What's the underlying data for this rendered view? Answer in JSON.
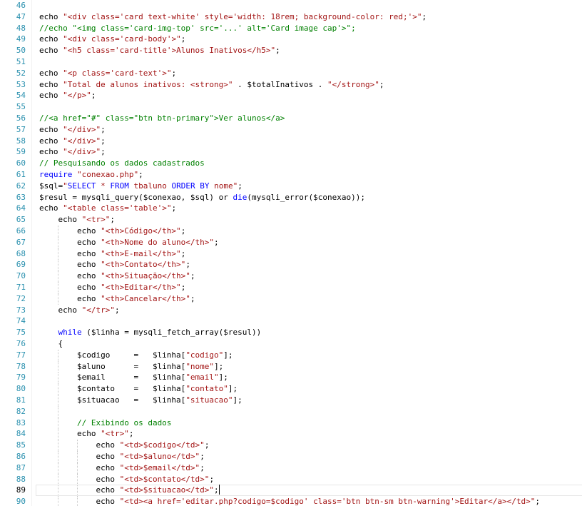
{
  "editor": {
    "active_line": 89,
    "lines": [
      {
        "n": "46",
        "t": []
      },
      {
        "n": "47",
        "t": [
          [
            "pl",
            "echo "
          ],
          [
            "str",
            "\"<div class='card text-white' style='width: 18rem; background-color: red;'>\""
          ],
          [
            "pl",
            ";"
          ]
        ]
      },
      {
        "n": "48",
        "t": [
          [
            "cm",
            "//echo \"<img class='card-img-top' src='...' alt='Card image cap'>\";"
          ]
        ]
      },
      {
        "n": "49",
        "t": [
          [
            "pl",
            "echo "
          ],
          [
            "str",
            "\"<div class='card-body'>\""
          ],
          [
            "pl",
            ";"
          ]
        ]
      },
      {
        "n": "50",
        "t": [
          [
            "pl",
            "echo "
          ],
          [
            "str",
            "\"<h5 class='card-title'>Alunos Inativos</h5>\""
          ],
          [
            "pl",
            ";"
          ]
        ]
      },
      {
        "n": "51",
        "t": []
      },
      {
        "n": "52",
        "t": [
          [
            "pl",
            "echo "
          ],
          [
            "str",
            "\"<p class='card-text'>\""
          ],
          [
            "pl",
            ";"
          ]
        ]
      },
      {
        "n": "53",
        "t": [
          [
            "pl",
            "echo "
          ],
          [
            "str",
            "\"Total de alunos inativos: <strong>\""
          ],
          [
            "pl",
            " . $totalInativos . "
          ],
          [
            "str",
            "\"</strong>\""
          ],
          [
            "pl",
            ";"
          ]
        ]
      },
      {
        "n": "54",
        "t": [
          [
            "pl",
            "echo "
          ],
          [
            "str",
            "\"</p>\""
          ],
          [
            "pl",
            ";"
          ]
        ]
      },
      {
        "n": "55",
        "t": []
      },
      {
        "n": "56",
        "t": [
          [
            "cm",
            "//<a href=\"#\" class=\"btn btn-primary\">Ver alunos</a>"
          ]
        ]
      },
      {
        "n": "57",
        "t": [
          [
            "pl",
            "echo "
          ],
          [
            "str",
            "\"</div>\""
          ],
          [
            "pl",
            ";"
          ]
        ]
      },
      {
        "n": "58",
        "t": [
          [
            "pl",
            "echo "
          ],
          [
            "str",
            "\"</div>\""
          ],
          [
            "pl",
            ";"
          ]
        ]
      },
      {
        "n": "59",
        "t": [
          [
            "pl",
            "echo "
          ],
          [
            "str",
            "\"</div>\""
          ],
          [
            "pl",
            ";"
          ]
        ]
      },
      {
        "n": "60",
        "t": [
          [
            "cm",
            "// Pesquisando os dados cadastrados"
          ]
        ]
      },
      {
        "n": "61",
        "t": [
          [
            "kw",
            "require "
          ],
          [
            "str",
            "\"conexao.php\""
          ],
          [
            "pl",
            ";"
          ]
        ]
      },
      {
        "n": "62",
        "t": [
          [
            "pl",
            "$sql="
          ],
          [
            "str",
            "\""
          ],
          [
            "sql",
            "SELECT"
          ],
          [
            "str",
            " * "
          ],
          [
            "sql",
            "FROM"
          ],
          [
            "str",
            " tbaluno "
          ],
          [
            "sql",
            "ORDER BY"
          ],
          [
            "str",
            " nome\""
          ],
          [
            "pl",
            ";"
          ]
        ]
      },
      {
        "n": "63",
        "t": [
          [
            "pl",
            "$resul = mysqli_query($conexao, $sql) or "
          ],
          [
            "kw",
            "die"
          ],
          [
            "pl",
            "(mysqli_error($conexao));"
          ]
        ]
      },
      {
        "n": "64",
        "t": [
          [
            "pl",
            "echo "
          ],
          [
            "str",
            "\"<table class='table'>\""
          ],
          [
            "pl",
            ";"
          ]
        ]
      },
      {
        "n": "65",
        "t": [
          [
            "pl",
            "    echo "
          ],
          [
            "str",
            "\"<tr>\""
          ],
          [
            "pl",
            ";"
          ]
        ]
      },
      {
        "n": "66",
        "t": [
          [
            "pl",
            "        echo "
          ],
          [
            "str",
            "\"<th>Código</th>\""
          ],
          [
            "pl",
            ";"
          ]
        ]
      },
      {
        "n": "67",
        "t": [
          [
            "pl",
            "        echo "
          ],
          [
            "str",
            "\"<th>Nome do aluno</th>\""
          ],
          [
            "pl",
            ";"
          ]
        ]
      },
      {
        "n": "68",
        "t": [
          [
            "pl",
            "        echo "
          ],
          [
            "str",
            "\"<th>E-mail</th>\""
          ],
          [
            "pl",
            ";"
          ]
        ]
      },
      {
        "n": "69",
        "t": [
          [
            "pl",
            "        echo "
          ],
          [
            "str",
            "\"<th>Contato</th>\""
          ],
          [
            "pl",
            ";"
          ]
        ]
      },
      {
        "n": "70",
        "t": [
          [
            "pl",
            "        echo "
          ],
          [
            "str",
            "\"<th>Situação</th>\""
          ],
          [
            "pl",
            ";"
          ]
        ]
      },
      {
        "n": "71",
        "t": [
          [
            "pl",
            "        echo "
          ],
          [
            "str",
            "\"<th>Editar</th>\""
          ],
          [
            "pl",
            ";"
          ]
        ]
      },
      {
        "n": "72",
        "t": [
          [
            "pl",
            "        echo "
          ],
          [
            "str",
            "\"<th>Cancelar</th>\""
          ],
          [
            "pl",
            ";"
          ]
        ]
      },
      {
        "n": "73",
        "t": [
          [
            "pl",
            "    echo "
          ],
          [
            "str",
            "\"</tr>\""
          ],
          [
            "pl",
            ";"
          ]
        ]
      },
      {
        "n": "74",
        "t": []
      },
      {
        "n": "75",
        "t": [
          [
            "kw",
            "    while"
          ],
          [
            "pl",
            " ($linha = mysqli_fetch_array($resul))"
          ]
        ]
      },
      {
        "n": "76",
        "t": [
          [
            "pl",
            "    {"
          ]
        ]
      },
      {
        "n": "77",
        "t": [
          [
            "pl",
            "        $codigo     =   $linha["
          ],
          [
            "str",
            "\"codigo\""
          ],
          [
            "pl",
            "];"
          ]
        ]
      },
      {
        "n": "78",
        "t": [
          [
            "pl",
            "        $aluno      =   $linha["
          ],
          [
            "str",
            "\"nome\""
          ],
          [
            "pl",
            "];"
          ]
        ]
      },
      {
        "n": "79",
        "t": [
          [
            "pl",
            "        $email      =   $linha["
          ],
          [
            "str",
            "\"email\""
          ],
          [
            "pl",
            "];"
          ]
        ]
      },
      {
        "n": "80",
        "t": [
          [
            "pl",
            "        $contato    =   $linha["
          ],
          [
            "str",
            "\"contato\""
          ],
          [
            "pl",
            "];"
          ]
        ]
      },
      {
        "n": "81",
        "t": [
          [
            "pl",
            "        $situacao   =   $linha["
          ],
          [
            "str",
            "\"situacao\""
          ],
          [
            "pl",
            "];"
          ]
        ]
      },
      {
        "n": "82",
        "t": []
      },
      {
        "n": "83",
        "t": [
          [
            "cm",
            "        // Exibindo os dados"
          ]
        ]
      },
      {
        "n": "84",
        "t": [
          [
            "pl",
            "        echo "
          ],
          [
            "str",
            "\"<tr>\""
          ],
          [
            "pl",
            ";"
          ]
        ]
      },
      {
        "n": "85",
        "t": [
          [
            "pl",
            "            echo "
          ],
          [
            "str",
            "\"<td>$codigo</td>\""
          ],
          [
            "pl",
            ";"
          ]
        ]
      },
      {
        "n": "86",
        "t": [
          [
            "pl",
            "            echo "
          ],
          [
            "str",
            "\"<td>$aluno</td>\""
          ],
          [
            "pl",
            ";"
          ]
        ]
      },
      {
        "n": "87",
        "t": [
          [
            "pl",
            "            echo "
          ],
          [
            "str",
            "\"<td>$email</td>\""
          ],
          [
            "pl",
            ";"
          ]
        ]
      },
      {
        "n": "88",
        "t": [
          [
            "pl",
            "            echo "
          ],
          [
            "str",
            "\"<td>$contato</td>\""
          ],
          [
            "pl",
            ";"
          ]
        ]
      },
      {
        "n": "89",
        "t": [
          [
            "pl",
            "            echo "
          ],
          [
            "str",
            "\"<td>$situacao</td>\""
          ],
          [
            "pl",
            ";"
          ]
        ]
      },
      {
        "n": "90",
        "t": [
          [
            "pl",
            "            echo "
          ],
          [
            "str",
            "\"<td><a href='editar.php?codigo=$codigo' class='btn btn-sm btn-warning'>Editar</a></td>\""
          ],
          [
            "pl",
            ";"
          ]
        ]
      }
    ]
  }
}
